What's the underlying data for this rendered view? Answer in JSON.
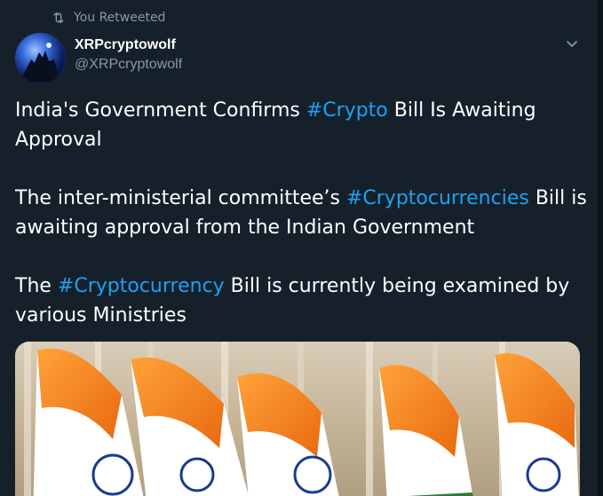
{
  "retweet": {
    "label": "You Retweeted",
    "icon": "retweet-icon"
  },
  "author": {
    "display_name": "XRPcryptowolf",
    "handle": "@XRPcryptowolf",
    "avatar_icon": "wolf-avatar"
  },
  "tweet": {
    "p1": {
      "before": "India's Government Confirms ",
      "hashtag": "#Crypto",
      "after": " Bill Is Awaiting Approval"
    },
    "p2": {
      "before": "The inter-ministerial committee’s ",
      "hashtag": "#Cryptocurrencies",
      "after": " Bill is awaiting approval from the Indian Government"
    },
    "p3": {
      "before": "The ",
      "hashtag": "#Cryptocurrency",
      "after": " Bill is currently being examined by various Ministries"
    }
  },
  "media": {
    "description_icon": "indian-flags-image"
  },
  "colors": {
    "background": "#15202b",
    "hashtag": "#1da1f2",
    "secondary_text": "#8899a6",
    "saffron": "#ff8a1d",
    "chakra_blue": "#1a3b8f"
  }
}
